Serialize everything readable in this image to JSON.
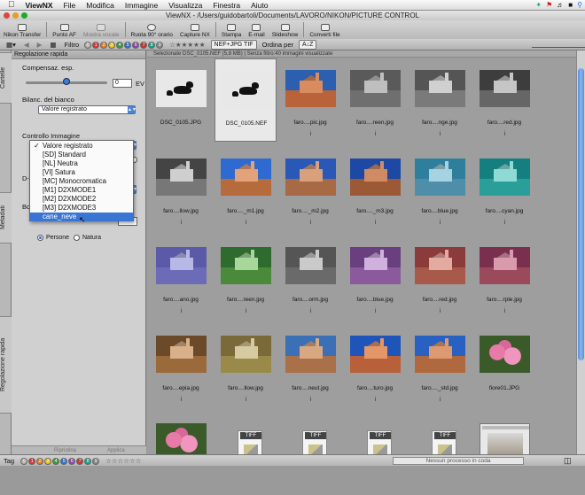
{
  "menubar": {
    "app": "ViewNX",
    "items": [
      "File",
      "Modifica",
      "Immagine",
      "Visualizza",
      "Finestra",
      "Aiuto"
    ]
  },
  "window": {
    "title": "ViewNX - /Users/guidobartoli/Documents/LAVORO/NIKON/PICTURE CONTROL"
  },
  "toolbar": {
    "buttons": [
      {
        "label": "Nikon Transfer",
        "icon": "transfer-icon"
      },
      {
        "label": "Punto AF",
        "icon": "af-point-icon"
      },
      {
        "label": "Mostra vocale",
        "icon": "voice-icon"
      },
      {
        "label": "Ruota 90° orario",
        "icon": "rotate-icon"
      },
      {
        "label": "Capture NX",
        "icon": "capture-nx-icon"
      },
      {
        "label": "Stampa",
        "icon": "print-icon"
      },
      {
        "label": "E-mail",
        "icon": "email-icon"
      },
      {
        "label": "Slideshow",
        "icon": "slideshow-icon"
      },
      {
        "label": "Converti file",
        "icon": "convert-icon"
      }
    ]
  },
  "filterbar": {
    "filter_label": "Filtro",
    "label_numbers": [
      "0",
      "1",
      "2",
      "3",
      "4",
      "5",
      "6",
      "7",
      "8",
      "9"
    ],
    "label_colors": [
      "#b0b0b0",
      "#d33",
      "#e67e22",
      "#e8c21b",
      "#3a9b3a",
      "#2f6fd1",
      "#8e44ad",
      "#c0392b",
      "#16a085",
      "#7f8c8d"
    ],
    "file_type": "NEF+JPG TIF",
    "sort_label": "Ordina per"
  },
  "side_tabs": {
    "cartelle": "Cartelle",
    "metadati": "Metadati",
    "regolazione": "Regolazione rapida"
  },
  "panel": {
    "header": "Regolazione rapida",
    "exposure_label": "Compensaz. esp.",
    "exposure_value": "0",
    "exposure_unit": "EV",
    "exposure_position": 0.5,
    "wb_label": "Bilanc. del bianco",
    "wb_value": "Valore registrato",
    "pc_label": "Controllo Immagine",
    "dlighting_label": "D-",
    "boost_label": "Boo",
    "radio_persone": "Persone",
    "radio_natura": "Natura",
    "footer_left": "Ripristina",
    "footer_right": "Applica"
  },
  "dropdown": {
    "options": [
      "Valore registrato",
      "[SD] Standard",
      "[NL] Neutra",
      "[VI] Satura",
      "[MC] Monocromatica",
      "[M1] D2XMODE1",
      "[M2] D2XMODE2",
      "[M3] D2XMODE3",
      "cane_neve"
    ],
    "checked_index": 0,
    "highlighted_index": 8
  },
  "content": {
    "info": "Selezionate DSC_0105.NEF (5,8 MB) | Senza filtro:40 immagini visualizzate"
  },
  "thumbnails": [
    {
      "caption": "DSC_0105.JPG",
      "kind": "dog"
    },
    {
      "caption": "DSC_0105.NEF",
      "kind": "dog",
      "selected": true
    },
    {
      "caption": "faro....pic.jpg",
      "kind": "house",
      "sky": "#2d5fb0",
      "ground": "#b8633a",
      "house": "#d98c5f"
    },
    {
      "caption": "faro....reen.jpg",
      "kind": "house",
      "sky": "#5a5a5a",
      "ground": "#6f6f6f",
      "house": "#bfbfbf"
    },
    {
      "caption": "faro....nge.jpg",
      "kind": "house",
      "sky": "#555",
      "ground": "#7a7a7a",
      "house": "#d0d0d0"
    },
    {
      "caption": "faro....red.jpg",
      "kind": "house",
      "sky": "#3d3d3d",
      "ground": "#666",
      "house": "#c5c5c5"
    },
    {
      "caption": "faro....llow.jpg",
      "kind": "house",
      "sky": "#444",
      "ground": "#777",
      "house": "#cfcfcf"
    },
    {
      "caption": "faro...._m1.jpg",
      "kind": "house",
      "sky": "#2f6ad0",
      "ground": "#b56b3c",
      "house": "#e4a27a"
    },
    {
      "caption": "faro...._m2.jpg",
      "kind": "house",
      "sky": "#2a58b6",
      "ground": "#a86a45",
      "house": "#d8a07c"
    },
    {
      "caption": "faro...._m3.jpg",
      "kind": "house",
      "sky": "#1d48a3",
      "ground": "#9b5a35",
      "house": "#cf8c64"
    },
    {
      "caption": "faro....blue.jpg",
      "kind": "house",
      "sky": "#2e7f9c",
      "ground": "#4f8ea8",
      "house": "#a6d3e2"
    },
    {
      "caption": "faro....cyan.jpg",
      "kind": "house",
      "sky": "#157f7f",
      "ground": "#2a9f9a",
      "house": "#8fdad4"
    },
    {
      "caption": "faro....ano.jpg",
      "kind": "house",
      "sky": "#5a5aa8",
      "ground": "#6b6bb8",
      "house": "#b8b8e6"
    },
    {
      "caption": "faro....reen.jpg",
      "kind": "house",
      "sky": "#2f6b2f",
      "ground": "#4a8a3a",
      "house": "#a8d79c"
    },
    {
      "caption": "faro....orm.jpg",
      "kind": "house",
      "sky": "#555",
      "ground": "#6a6a6a",
      "house": "#cacaca"
    },
    {
      "caption": "faro....blue.jpg",
      "kind": "house",
      "sky": "#6a3f80",
      "ground": "#8a5a9c",
      "house": "#d0b0dc"
    },
    {
      "caption": "faro....red.jpg",
      "kind": "house",
      "sky": "#8c3b3b",
      "ground": "#a85a4a",
      "house": "#e3aaa0"
    },
    {
      "caption": "faro....rple.jpg",
      "kind": "house",
      "sky": "#7a2f4f",
      "ground": "#9a4a5a",
      "house": "#d89aac"
    },
    {
      "caption": "faro....epia.jpg",
      "kind": "house",
      "sky": "#6b4a2a",
      "ground": "#9a6a3a",
      "house": "#d8b08a"
    },
    {
      "caption": "faro....llow.jpg",
      "kind": "house",
      "sky": "#7a6a3a",
      "ground": "#9a8a4a",
      "house": "#d6caa0"
    },
    {
      "caption": "faro....neut.jpg",
      "kind": "house",
      "sky": "#3b6fb6",
      "ground": "#a9704a",
      "house": "#d8a882"
    },
    {
      "caption": "faro....turo.jpg",
      "kind": "house",
      "sky": "#1f55b8",
      "ground": "#b8603a",
      "house": "#e39668"
    },
    {
      "caption": "faro...._std.jpg",
      "kind": "house",
      "sky": "#2961c2",
      "ground": "#b0683e",
      "house": "#dd9a72"
    },
    {
      "caption": "fiore01.JPG",
      "kind": "flower"
    },
    {
      "caption": "",
      "kind": "flower"
    },
    {
      "caption": "",
      "kind": "tiff"
    },
    {
      "caption": "",
      "kind": "tiff"
    },
    {
      "caption": "",
      "kind": "tiff"
    },
    {
      "caption": "",
      "kind": "tiff"
    },
    {
      "caption": "",
      "kind": "window"
    }
  ],
  "statusbar": {
    "tag_label": "Tag",
    "queue": "Nessun processo in coda"
  }
}
